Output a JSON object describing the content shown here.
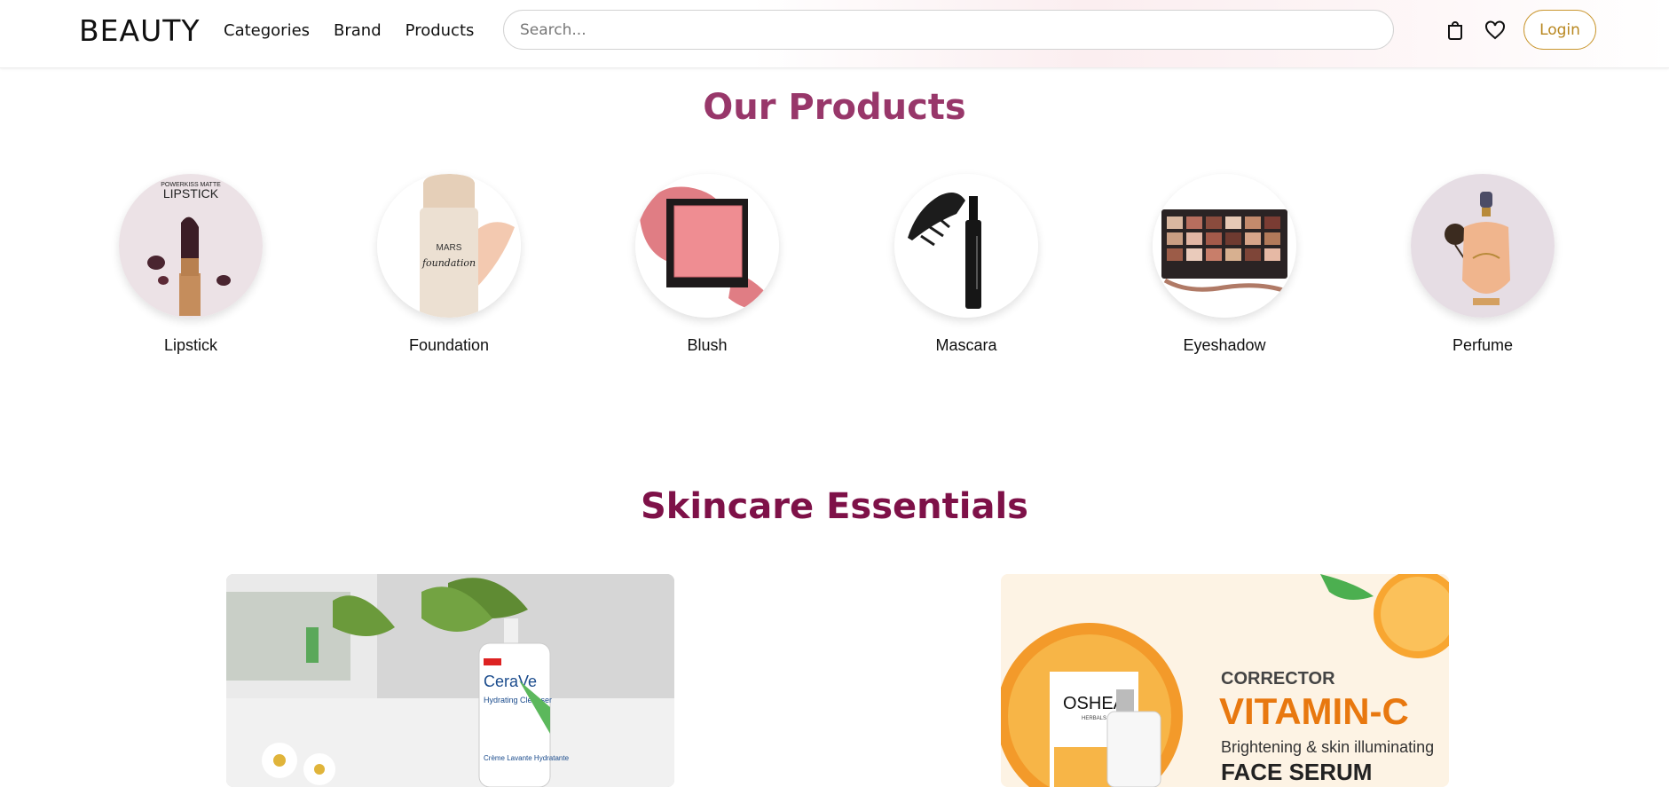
{
  "header": {
    "brand": "BEAUTY",
    "nav": [
      {
        "label": "Categories"
      },
      {
        "label": "Brand"
      },
      {
        "label": "Products"
      }
    ],
    "search_placeholder": "Search...",
    "login_label": "Login",
    "icons": [
      "shopping-bag-icon",
      "heart-icon"
    ]
  },
  "products_section": {
    "title": "Our Products",
    "items": [
      {
        "label": "Lipstick",
        "image_text_top": "POWERKISS MATTE",
        "image_text_main": "LIPSTICK"
      },
      {
        "label": "Foundation",
        "image_text_main": "MARS"
      },
      {
        "label": "Blush"
      },
      {
        "label": "Mascara"
      },
      {
        "label": "Eyeshadow"
      },
      {
        "label": "Perfume"
      }
    ]
  },
  "skincare_section": {
    "title": "Skincare Essentials",
    "cards": [
      {
        "image_text_brand": "CeraVe",
        "image_text_product": "Hydrating Cleanser",
        "image_text_fr": "Crème Lavante Hydratante"
      },
      {
        "image_text_brand": "OSHEA",
        "image_text_sub": "HERBALS",
        "image_text_kicker": "CORRECTOR",
        "image_text_main": "VITAMIN-C",
        "image_text_desc": "Brightening & skin illuminating",
        "image_text_tail": "FACE SERUM"
      }
    ]
  },
  "colors": {
    "title_products": "#98376a",
    "title_skincare": "#7e1148",
    "login_accent": "#c9962e"
  }
}
